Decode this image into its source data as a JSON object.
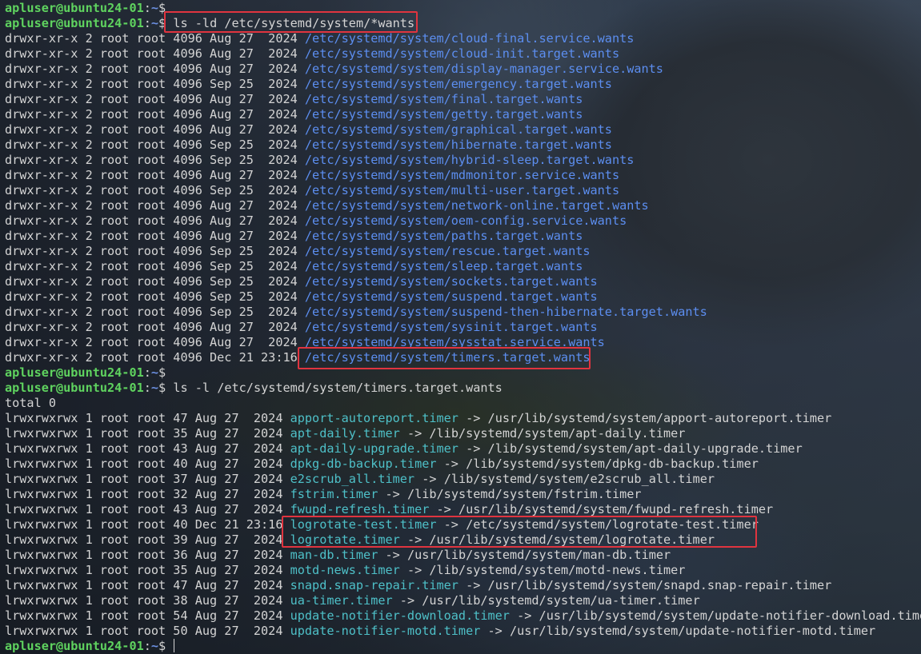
{
  "prompt": {
    "user_host": "apluser@ubuntu24-01",
    "colon": ":",
    "path": "~",
    "symbol": "$"
  },
  "command1": "ls -ld /etc/systemd/system/*wants",
  "dir_entries": [
    {
      "meta": "drwxr-xr-x 2 root root 4096 Aug 27  2024",
      "path": "/etc/systemd/system/cloud-final.service.wants"
    },
    {
      "meta": "drwxr-xr-x 2 root root 4096 Aug 27  2024",
      "path": "/etc/systemd/system/cloud-init.target.wants"
    },
    {
      "meta": "drwxr-xr-x 2 root root 4096 Aug 27  2024",
      "path": "/etc/systemd/system/display-manager.service.wants"
    },
    {
      "meta": "drwxr-xr-x 2 root root 4096 Sep 25  2024",
      "path": "/etc/systemd/system/emergency.target.wants"
    },
    {
      "meta": "drwxr-xr-x 2 root root 4096 Aug 27  2024",
      "path": "/etc/systemd/system/final.target.wants"
    },
    {
      "meta": "drwxr-xr-x 2 root root 4096 Aug 27  2024",
      "path": "/etc/systemd/system/getty.target.wants"
    },
    {
      "meta": "drwxr-xr-x 2 root root 4096 Aug 27  2024",
      "path": "/etc/systemd/system/graphical.target.wants"
    },
    {
      "meta": "drwxr-xr-x 2 root root 4096 Sep 25  2024",
      "path": "/etc/systemd/system/hibernate.target.wants"
    },
    {
      "meta": "drwxr-xr-x 2 root root 4096 Sep 25  2024",
      "path": "/etc/systemd/system/hybrid-sleep.target.wants"
    },
    {
      "meta": "drwxr-xr-x 2 root root 4096 Aug 27  2024",
      "path": "/etc/systemd/system/mdmonitor.service.wants"
    },
    {
      "meta": "drwxr-xr-x 2 root root 4096 Sep 25  2024",
      "path": "/etc/systemd/system/multi-user.target.wants"
    },
    {
      "meta": "drwxr-xr-x 2 root root 4096 Aug 27  2024",
      "path": "/etc/systemd/system/network-online.target.wants"
    },
    {
      "meta": "drwxr-xr-x 2 root root 4096 Aug 27  2024",
      "path": "/etc/systemd/system/oem-config.service.wants"
    },
    {
      "meta": "drwxr-xr-x 2 root root 4096 Aug 27  2024",
      "path": "/etc/systemd/system/paths.target.wants"
    },
    {
      "meta": "drwxr-xr-x 2 root root 4096 Sep 25  2024",
      "path": "/etc/systemd/system/rescue.target.wants"
    },
    {
      "meta": "drwxr-xr-x 2 root root 4096 Sep 25  2024",
      "path": "/etc/systemd/system/sleep.target.wants"
    },
    {
      "meta": "drwxr-xr-x 2 root root 4096 Sep 25  2024",
      "path": "/etc/systemd/system/sockets.target.wants"
    },
    {
      "meta": "drwxr-xr-x 2 root root 4096 Sep 25  2024",
      "path": "/etc/systemd/system/suspend.target.wants"
    },
    {
      "meta": "drwxr-xr-x 2 root root 4096 Sep 25  2024",
      "path": "/etc/systemd/system/suspend-then-hibernate.target.wants"
    },
    {
      "meta": "drwxr-xr-x 2 root root 4096 Aug 27  2024",
      "path": "/etc/systemd/system/sysinit.target.wants"
    },
    {
      "meta": "drwxr-xr-x 2 root root 4096 Aug 27  2024",
      "path": "/etc/systemd/system/sysstat.service.wants"
    },
    {
      "meta": "drwxr-xr-x 2 root root 4096 Dec 21 23:16",
      "path": "/etc/systemd/system/timers.target.wants"
    }
  ],
  "command2": "ls -l /etc/systemd/system/timers.target.wants",
  "total_line": "total 0",
  "link_entries": [
    {
      "meta": "lrwxrwxrwx 1 root root 47 Aug 27  2024",
      "name": "apport-autoreport.timer",
      "target": "/usr/lib/systemd/system/apport-autoreport.timer"
    },
    {
      "meta": "lrwxrwxrwx 1 root root 35 Aug 27  2024",
      "name": "apt-daily.timer",
      "target": "/lib/systemd/system/apt-daily.timer"
    },
    {
      "meta": "lrwxrwxrwx 1 root root 43 Aug 27  2024",
      "name": "apt-daily-upgrade.timer",
      "target": "/lib/systemd/system/apt-daily-upgrade.timer"
    },
    {
      "meta": "lrwxrwxrwx 1 root root 40 Aug 27  2024",
      "name": "dpkg-db-backup.timer",
      "target": "/lib/systemd/system/dpkg-db-backup.timer"
    },
    {
      "meta": "lrwxrwxrwx 1 root root 37 Aug 27  2024",
      "name": "e2scrub_all.timer",
      "target": "/lib/systemd/system/e2scrub_all.timer"
    },
    {
      "meta": "lrwxrwxrwx 1 root root 32 Aug 27  2024",
      "name": "fstrim.timer",
      "target": "/lib/systemd/system/fstrim.timer"
    },
    {
      "meta": "lrwxrwxrwx 1 root root 43 Aug 27  2024",
      "name": "fwupd-refresh.timer",
      "target": "/usr/lib/systemd/system/fwupd-refresh.timer"
    },
    {
      "meta": "lrwxrwxrwx 1 root root 40 Dec 21 23:16",
      "name": "logrotate-test.timer",
      "target": "/etc/systemd/system/logrotate-test.timer"
    },
    {
      "meta": "lrwxrwxrwx 1 root root 39 Aug 27  2024",
      "name": "logrotate.timer",
      "target": "/usr/lib/systemd/system/logrotate.timer"
    },
    {
      "meta": "lrwxrwxrwx 1 root root 36 Aug 27  2024",
      "name": "man-db.timer",
      "target": "/usr/lib/systemd/system/man-db.timer"
    },
    {
      "meta": "lrwxrwxrwx 1 root root 35 Aug 27  2024",
      "name": "motd-news.timer",
      "target": "/lib/systemd/system/motd-news.timer"
    },
    {
      "meta": "lrwxrwxrwx 1 root root 47 Aug 27  2024",
      "name": "snapd.snap-repair.timer",
      "target": "/usr/lib/systemd/system/snapd.snap-repair.timer"
    },
    {
      "meta": "lrwxrwxrwx 1 root root 38 Aug 27  2024",
      "name": "ua-timer.timer",
      "target": "/usr/lib/systemd/system/ua-timer.timer"
    },
    {
      "meta": "lrwxrwxrwx 1 root root 54 Aug 27  2024",
      "name": "update-notifier-download.timer",
      "target": "/usr/lib/systemd/system/update-notifier-download.timer"
    },
    {
      "meta": "lrwxrwxrwx 1 root root 50 Aug 27  2024",
      "name": "update-notifier-motd.timer",
      "target": "/usr/lib/systemd/system/update-notifier-motd.timer"
    }
  ],
  "arrow": "->",
  "colors": {
    "prompt_user": "#5fd35f",
    "prompt_path": "#6b8fe0",
    "directory": "#5c8ef0",
    "symlink": "#4ec0c8",
    "text": "#d4d4d4",
    "highlight_box": "#e0343f"
  }
}
